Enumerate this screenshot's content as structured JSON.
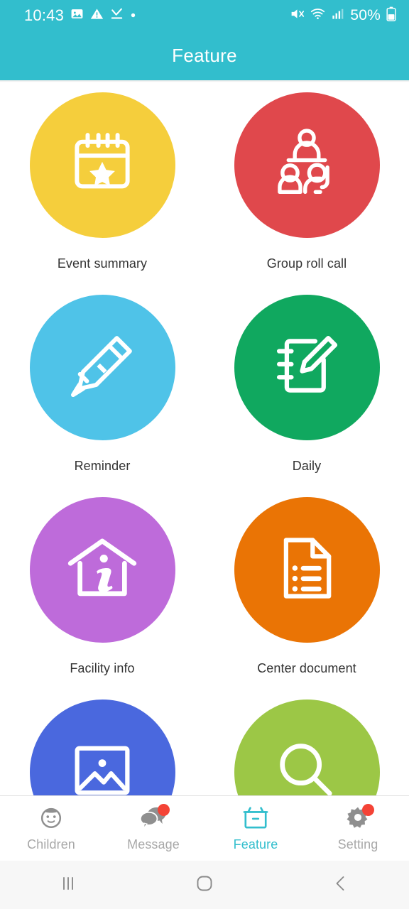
{
  "theme": {
    "accent": "#32BECD",
    "label_color": "#333333",
    "tab_inactive": "#a8a8a8",
    "badge_color": "#F44336"
  },
  "status_bar": {
    "time": "10:43",
    "battery_percent": "50%",
    "left_icons": [
      "image-icon",
      "warning-triangle-icon",
      "download-complete-icon",
      "dot-icon"
    ],
    "right_icons": [
      "mute-icon",
      "wifi-icon",
      "signal-bars-icon",
      "battery-icon"
    ]
  },
  "app_bar": {
    "title": "Feature"
  },
  "features": [
    {
      "label": "Event summary",
      "icon": "calendar-star-icon",
      "color": "#F5CE3C"
    },
    {
      "label": "Group roll call",
      "icon": "group-rollcall-icon",
      "color": "#E0484C"
    },
    {
      "label": "Reminder",
      "icon": "pencil-icon",
      "color": "#4FC3E8"
    },
    {
      "label": "Daily",
      "icon": "notebook-edit-icon",
      "color": "#10A85F"
    },
    {
      "label": "Facility info",
      "icon": "house-info-icon",
      "color": "#BE6BDA"
    },
    {
      "label": "Center document",
      "icon": "document-list-icon",
      "color": "#EA7405"
    },
    {
      "label": "",
      "icon": "photo-icon",
      "color": "#4A68DE"
    },
    {
      "label": "",
      "icon": "search-icon",
      "color": "#9CC council"
    }
  ],
  "tabs": [
    {
      "label": "Children",
      "icon": "baby-face-icon",
      "active": false,
      "badge": false
    },
    {
      "label": "Message",
      "icon": "chat-bubbles-icon",
      "active": false,
      "badge": true
    },
    {
      "label": "Feature",
      "icon": "archive-box-icon",
      "active": true,
      "badge": false
    },
    {
      "label": "Setting",
      "icon": "gear-icon",
      "active": false,
      "badge": true
    }
  ],
  "nav_bar": {
    "buttons": [
      {
        "name": "recents-button",
        "icon": "recents-icon"
      },
      {
        "name": "home-button",
        "icon": "home-circle-icon"
      },
      {
        "name": "back-button",
        "icon": "back-chevron-icon"
      }
    ]
  }
}
